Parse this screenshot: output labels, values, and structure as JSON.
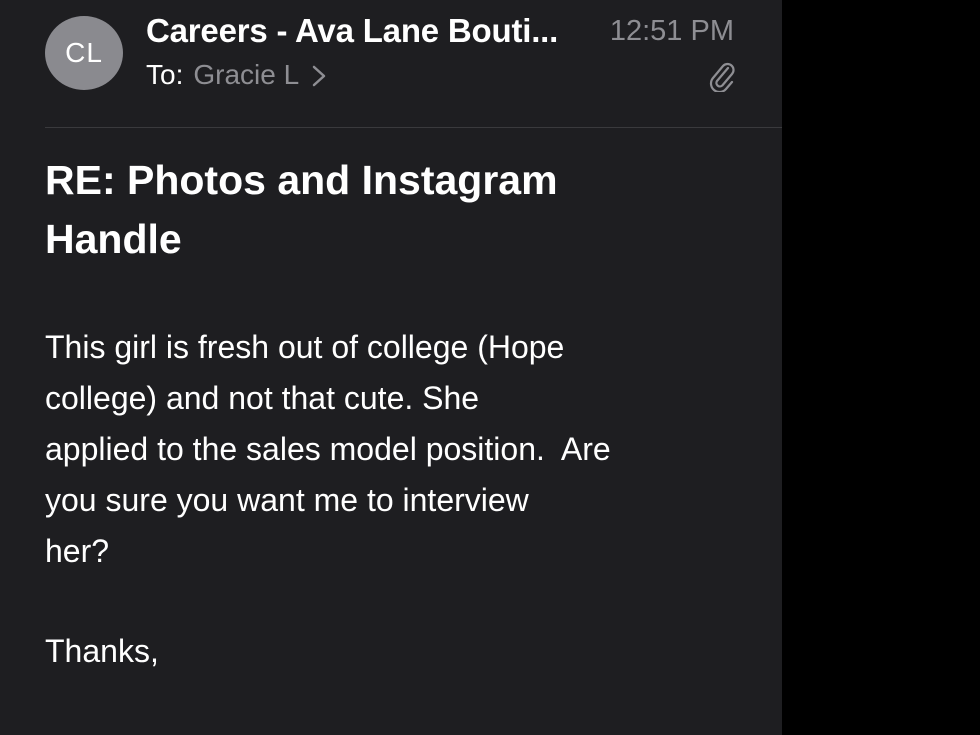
{
  "header": {
    "avatar_initials": "CL",
    "sender": "Careers - Ava Lane Bouti...",
    "time": "12:51 PM",
    "to_label": "To:",
    "recipient": "Gracie L",
    "chevron_icon": "chevron-right-icon",
    "attachment_icon": "paperclip-icon"
  },
  "message": {
    "subject_lines": [
      "RE: Photos and Instagram",
      "Handle"
    ],
    "body_lines": [
      "This girl is fresh out of college (Hope",
      "college) and not that cute. She",
      "applied to the sales model position.  Are",
      "you sure you want me to interview",
      "her?"
    ],
    "signoff": "Thanks,"
  },
  "colors": {
    "background": "#1e1e21",
    "text_primary": "#ffffff",
    "text_secondary": "#8e8e93",
    "avatar": "#8a8a8f"
  }
}
